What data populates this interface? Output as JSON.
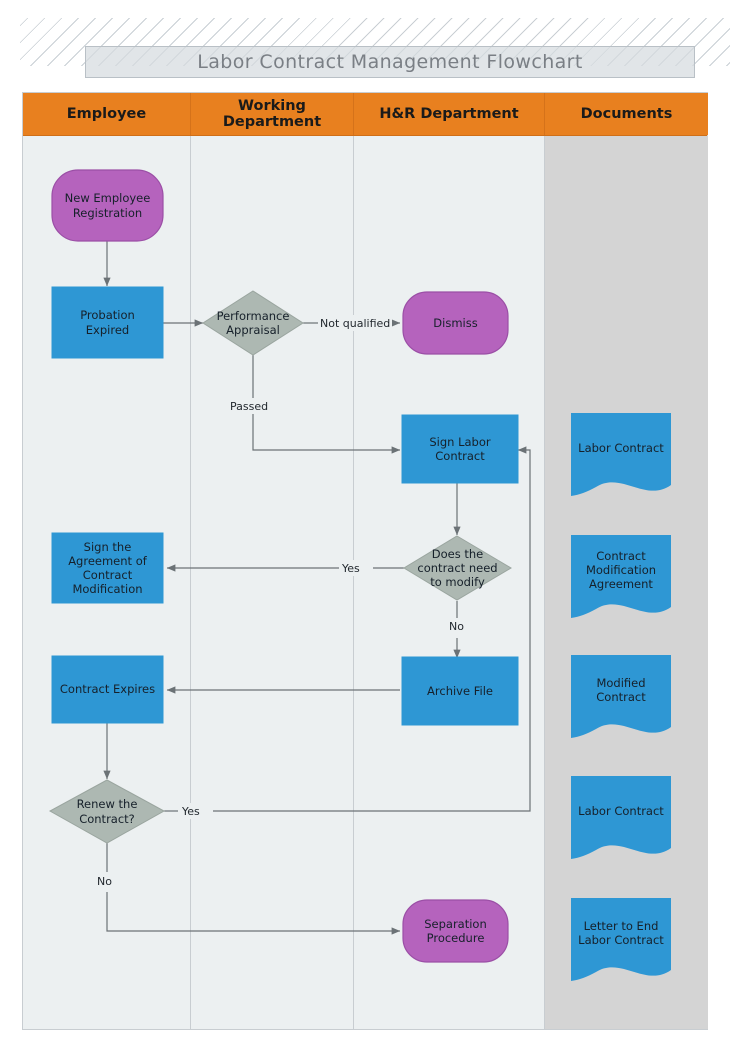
{
  "title": "Labor Contract Management Flowchart",
  "colors": {
    "lane_header": "#e8801f",
    "lane_body": "#ecf0f1",
    "lane_body_documents": "#d4d4d4",
    "process": "#2e97d4",
    "terminator": "#b563bd",
    "decision": "#adb8b2",
    "connector": "#6b7276",
    "text": "#16202a",
    "banner_box": "#d6dbdf"
  },
  "lanes": [
    {
      "id": "employee",
      "label": "Employee"
    },
    {
      "id": "working",
      "label": "Working\nDepartment",
      "line1": "Working",
      "line2": "Department"
    },
    {
      "id": "hr",
      "label": "H&R Department"
    },
    {
      "id": "documents",
      "label": "Documents"
    }
  ],
  "nodes": [
    {
      "id": "new-employee-registration",
      "lane": "employee",
      "type": "terminator",
      "label": "New Employee Registration",
      "line1": "New Employee",
      "line2": "Registration"
    },
    {
      "id": "probation-expired",
      "lane": "employee",
      "type": "process",
      "label": "Probation Expired",
      "line1": "Probation",
      "line2": "Expired"
    },
    {
      "id": "performance-appraisal",
      "lane": "working",
      "type": "decision",
      "label": "Performance Appraisal",
      "line1": "Performance",
      "line2": "Appraisal"
    },
    {
      "id": "dismiss",
      "lane": "hr",
      "type": "terminator",
      "label": "Dismiss"
    },
    {
      "id": "sign-labor-contract",
      "lane": "hr",
      "type": "process",
      "label": "Sign Labor Contract",
      "line1": "Sign Labor",
      "line2": "Contract"
    },
    {
      "id": "does-the-contract-need-to-modify",
      "lane": "hr",
      "type": "decision",
      "label": "Does the contract need to modify",
      "line1": "Does the",
      "line2": "contract need",
      "line3": "to modify"
    },
    {
      "id": "sign-agreement-of-contract-modification",
      "lane": "employee",
      "type": "process",
      "label": "Sign the Agreement of Contract Modification",
      "line1": "Sign the",
      "line2": "Agreement of",
      "line3": "Contract",
      "line4": "Modification"
    },
    {
      "id": "archive-file",
      "lane": "hr",
      "type": "process",
      "label": "Archive File"
    },
    {
      "id": "contract-expires",
      "lane": "employee",
      "type": "process",
      "label": "Contract Expires"
    },
    {
      "id": "renew-the-contract",
      "lane": "employee",
      "type": "decision",
      "label": "Renew the Contract?",
      "line1": "Renew the",
      "line2": "Contract?"
    },
    {
      "id": "separation-procedure",
      "lane": "hr",
      "type": "terminator",
      "label": "Separation Procedure",
      "line1": "Separation",
      "line2": "Procedure"
    }
  ],
  "documents": [
    {
      "id": "doc-labor-contract-1",
      "label": "Labor Contract"
    },
    {
      "id": "doc-contract-modification-agreement",
      "label": "Contract Modification Agreement",
      "line1": "Contract",
      "line2": "Modification",
      "line3": "Agreement"
    },
    {
      "id": "doc-modified-contract",
      "label": "Modified Contract",
      "line1": "Modified",
      "line2": "Contract"
    },
    {
      "id": "doc-labor-contract-2",
      "label": "Labor Contract"
    },
    {
      "id": "doc-letter-to-end-labor-contract",
      "label": "Letter to End Labor Contract",
      "line1": "Letter to End",
      "line2": "Labor Contract"
    }
  ],
  "edges": [
    {
      "id": "edge-not-qualified",
      "from": "performance-appraisal",
      "to": "dismiss",
      "label": "Not qualified"
    },
    {
      "id": "edge-passed",
      "from": "performance-appraisal",
      "to": "sign-labor-contract",
      "label": "Passed"
    },
    {
      "id": "edge-modify-yes",
      "from": "does-the-contract-need-to-modify",
      "to": "sign-agreement-of-contract-modification",
      "label": "Yes"
    },
    {
      "id": "edge-modify-no",
      "from": "does-the-contract-need-to-modify",
      "to": "archive-file",
      "label": "No"
    },
    {
      "id": "edge-renew-yes",
      "from": "renew-the-contract",
      "to": "sign-labor-contract",
      "label": "Yes"
    },
    {
      "id": "edge-renew-no",
      "from": "renew-the-contract",
      "to": "separation-procedure",
      "label": "No"
    },
    {
      "id": "edge-registration-to-probation",
      "from": "new-employee-registration",
      "to": "probation-expired",
      "label": ""
    },
    {
      "id": "edge-probation-to-appraisal",
      "from": "probation-expired",
      "to": "performance-appraisal",
      "label": ""
    },
    {
      "id": "edge-sign-to-decision",
      "from": "sign-labor-contract",
      "to": "does-the-contract-need-to-modify",
      "label": ""
    },
    {
      "id": "edge-archive-to-expires",
      "from": "archive-file",
      "to": "contract-expires",
      "label": ""
    },
    {
      "id": "edge-expires-to-renew",
      "from": "contract-expires",
      "to": "renew-the-contract",
      "label": ""
    }
  ]
}
